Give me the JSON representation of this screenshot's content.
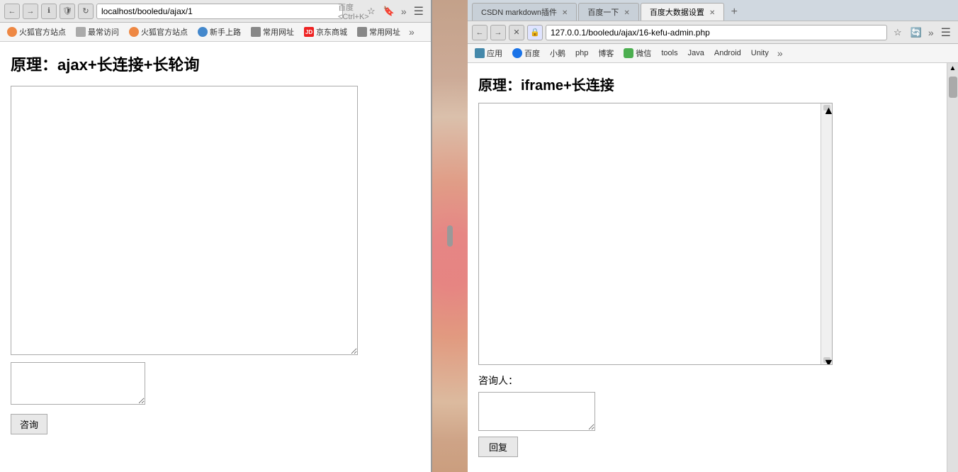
{
  "left_browser": {
    "url": "localhost/booledu/ajax/1",
    "search_placeholder": "百度 <Ctrl+K>",
    "bookmarks": [
      {
        "label": "火狐官方站点",
        "icon": "fox"
      },
      {
        "label": "最常访问",
        "icon": "plain"
      },
      {
        "label": "火狐官方站点",
        "icon": "fox"
      },
      {
        "label": "新手上路",
        "icon": "orange"
      },
      {
        "label": "常用网址",
        "icon": "plain"
      },
      {
        "label": "京东商城",
        "icon": "jd"
      },
      {
        "label": "常用网址",
        "icon": "plain"
      }
    ],
    "page_title": "原理：ajax+长连接+长轮询",
    "send_button": "咨询"
  },
  "right_browser": {
    "tabs": [
      {
        "label": "CSDN markdown插件",
        "active": false
      },
      {
        "label": "百度一下",
        "active": false
      },
      {
        "label": "百度大数据设置",
        "active": true
      }
    ],
    "url": "127.0.0.1/booledu/ajax/16-kefu-admin.php",
    "bookmarks": [
      {
        "label": "应用"
      },
      {
        "label": "百度"
      },
      {
        "label": "小鹅"
      },
      {
        "label": "php"
      },
      {
        "label": "博客"
      },
      {
        "label": "微信"
      },
      {
        "label": "tools"
      },
      {
        "label": "Java"
      },
      {
        "label": "Android"
      },
      {
        "label": "Unity"
      }
    ],
    "page_title": "原理：iframe+长连接",
    "consultant_label": "咨询人：",
    "reply_button": "回复"
  }
}
